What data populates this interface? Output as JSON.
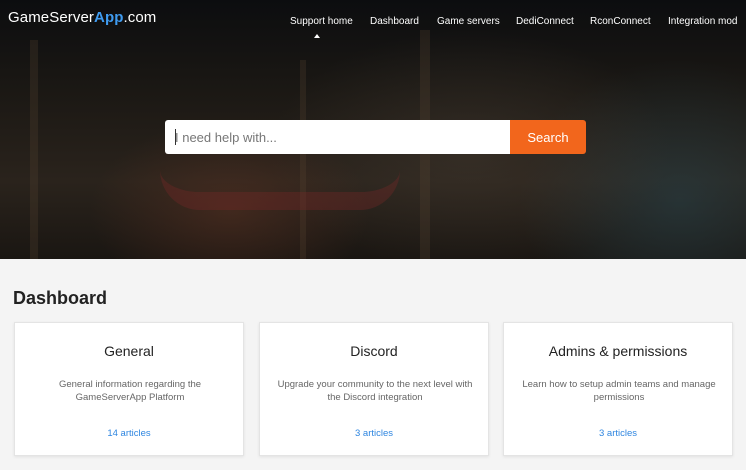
{
  "brand": {
    "part1": "GameServer",
    "part2": "App",
    "part3": ".com"
  },
  "nav": {
    "items": [
      "Support home",
      "Dashboard",
      "Game servers",
      "DediConnect",
      "RconConnect",
      "Integration mod"
    ]
  },
  "search": {
    "placeholder": "I need help with...",
    "button_label": "Search"
  },
  "section": {
    "title": "Dashboard"
  },
  "cards": [
    {
      "title": "General",
      "description": "General information regarding the GameServerApp Platform",
      "link": "14 articles"
    },
    {
      "title": "Discord",
      "description": "Upgrade your community to the next level with the Discord integration",
      "link": "3 articles"
    },
    {
      "title": "Admins & permissions",
      "description": "Learn how to setup admin teams and manage permissions",
      "link": "3 articles"
    }
  ],
  "colors": {
    "accent": "#f2661c",
    "brand_blue": "#3f9bf0",
    "link": "#2f86e0"
  }
}
